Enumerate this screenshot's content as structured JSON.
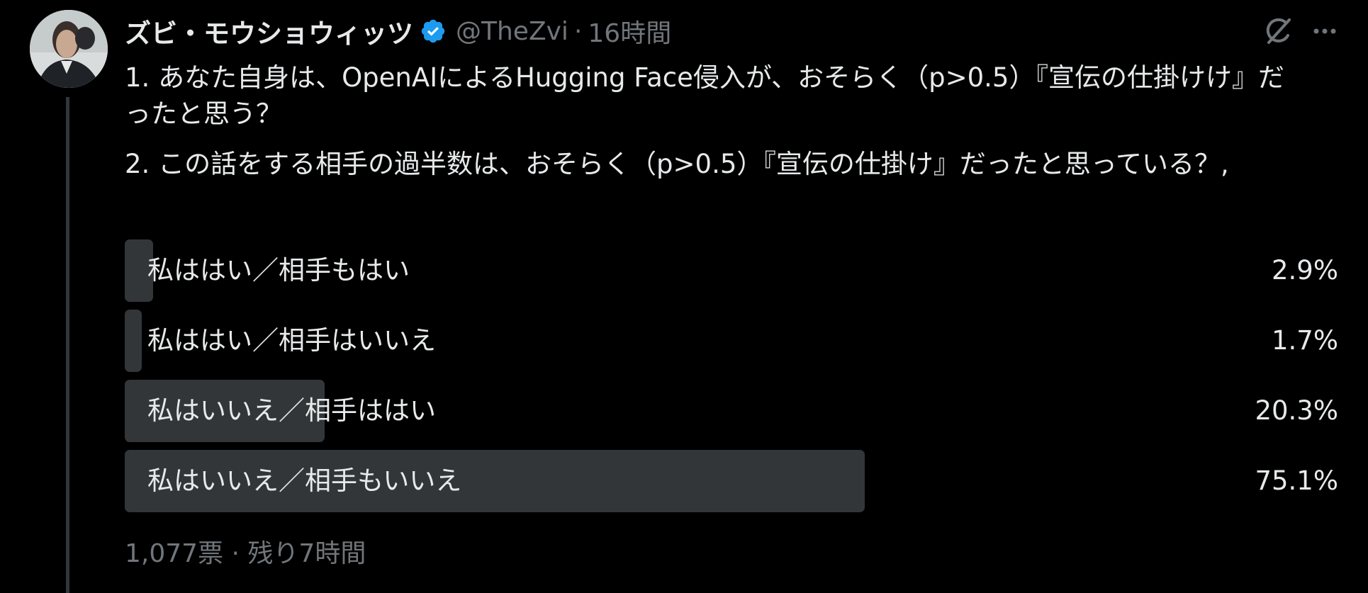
{
  "user": {
    "display_name": "ズビ・モウショウィッツ",
    "handle": "@TheZvi",
    "separator": "·",
    "time": "16時間",
    "verified": true,
    "verified_color": "#1d9bf0",
    "avatar_icon": "user-avatar"
  },
  "tweet": {
    "paragraphs": [
      "1. あなた自身は、OpenAIによるHugging Face侵入が、おそらく（p>0.5）『宣伝の仕掛けけ』だったと思う？",
      "2. この話をする相手の過半数は、おそらく（p>0.5）『宣伝の仕掛け』だったと思っている？,"
    ]
  },
  "poll": {
    "options": [
      {
        "label": "私ははい／相手もはい",
        "percent_text": "2.9%",
        "percent": 2.9
      },
      {
        "label": "私ははい／相手はいいえ",
        "percent_text": "1.7%",
        "percent": 1.7
      },
      {
        "label": "私はいいえ／相手ははい",
        "percent_text": "20.3%",
        "percent": 20.3
      },
      {
        "label": "私はいいえ／相手もいいえ",
        "percent_text": "75.1%",
        "percent": 75.1
      }
    ],
    "votes": "1,077票",
    "separator": "·",
    "remaining": "残り7時間"
  },
  "icons": {
    "grok": "grok-icon",
    "more": "more-options-icon"
  },
  "colors": {
    "background": "#000000",
    "text": "#e7e9ea",
    "secondary": "#71767b",
    "poll_bar": "#333639",
    "verified": "#1d9bf0"
  }
}
